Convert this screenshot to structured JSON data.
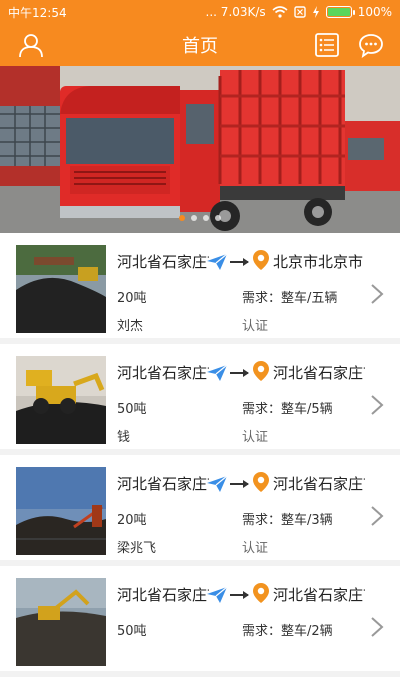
{
  "status": {
    "time": "中午12:54",
    "speed": "... 7.03K/s",
    "battery": "100%",
    "battery_level": 1.0
  },
  "header": {
    "title": "首页"
  },
  "banner": {
    "slide_count": 4,
    "active_index": 0
  },
  "colors": {
    "accent": "#f78a1f",
    "send": "#3a8ee6",
    "pin": "#f2931f"
  },
  "listings": [
    {
      "origin": "河北省石家庄市",
      "destination": "北京市北京市",
      "weight": "20吨",
      "demand": "需求：整车/五辆",
      "person": "刘杰",
      "cert": "认证"
    },
    {
      "origin": "河北省石家庄市",
      "destination": "河北省石家庄市",
      "weight": "50吨",
      "demand": "需求：整车/5辆",
      "person": "钱",
      "cert": "认证"
    },
    {
      "origin": "河北省石家庄市",
      "destination": "河北省石家庄市",
      "weight": "20吨",
      "demand": "需求：整车/3辆",
      "person": "梁兆飞",
      "cert": "认证"
    },
    {
      "origin": "河北省石家庄市",
      "destination": "河北省石家庄市",
      "weight": "50吨",
      "demand": "需求：整车/2辆",
      "person": "",
      "cert": ""
    }
  ]
}
